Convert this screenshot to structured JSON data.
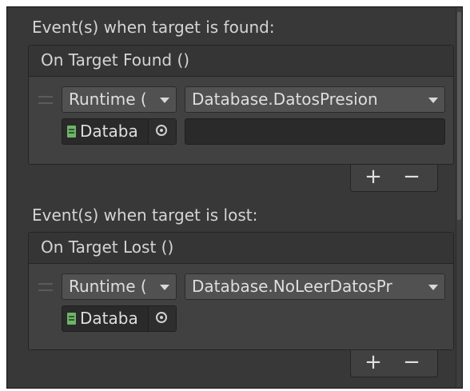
{
  "found": {
    "label": "Event(s) when target is found:",
    "header": "On Target Found ()",
    "runtime": "Runtime (",
    "function": "Database.DatosPresion",
    "object": "Databa",
    "argument": "",
    "add": "+",
    "remove": "−"
  },
  "lost": {
    "label": "Event(s) when target is lost:",
    "header": "On Target Lost ()",
    "runtime": "Runtime (",
    "function": "Database.NoLeerDatosPr",
    "object": "Databa",
    "add": "+",
    "remove": "−"
  },
  "colors": {
    "panel": "#383838",
    "field": "#515151",
    "object_field": "#2a2a2a",
    "script_icon": "#6fb46a"
  },
  "icons": [
    "drag-handle-icon",
    "chevron-down-icon",
    "script-icon",
    "object-picker-icon"
  ]
}
